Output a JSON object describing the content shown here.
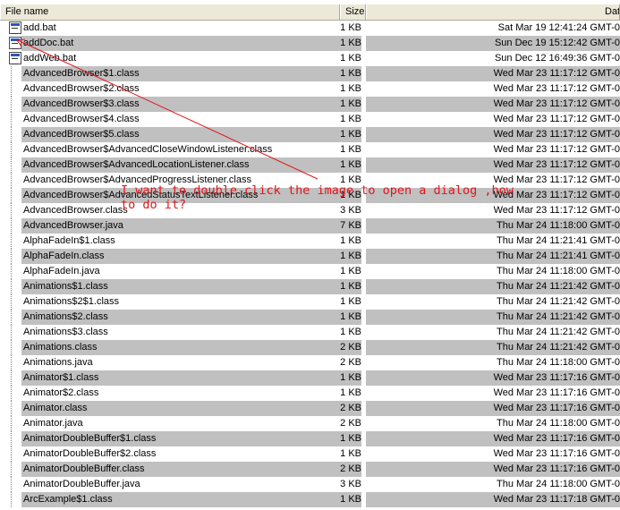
{
  "columns": {
    "name": "File name",
    "size": "Size",
    "date": "Date"
  },
  "annotation": {
    "line1": "I want to double click the image to open a dialog ,how",
    "line2": "to do it?",
    "color": "#e0161b"
  },
  "files": [
    {
      "name": "add.bat",
      "size": "1 KB",
      "date": "Sat Mar 19 12:41:24 GMT-0",
      "icon": "batch-file-icon"
    },
    {
      "name": "addDoc.bat",
      "size": "1 KB",
      "date": "Sun Dec 19 15:12:42 GMT-0",
      "icon": "batch-file-icon"
    },
    {
      "name": "addWeb.bat",
      "size": "1 KB",
      "date": "Sun Dec 12 16:49:36 GMT-0",
      "icon": "batch-file-icon"
    },
    {
      "name": "AdvancedBrowser$1.class",
      "size": "1 KB",
      "date": "Wed Mar 23 11:17:12 GMT-0"
    },
    {
      "name": "AdvancedBrowser$2.class",
      "size": "1 KB",
      "date": "Wed Mar 23 11:17:12 GMT-0"
    },
    {
      "name": "AdvancedBrowser$3.class",
      "size": "1 KB",
      "date": "Wed Mar 23 11:17:12 GMT-0"
    },
    {
      "name": "AdvancedBrowser$4.class",
      "size": "1 KB",
      "date": "Wed Mar 23 11:17:12 GMT-0"
    },
    {
      "name": "AdvancedBrowser$5.class",
      "size": "1 KB",
      "date": "Wed Mar 23 11:17:12 GMT-0"
    },
    {
      "name": "AdvancedBrowser$AdvancedCloseWindowListener.class",
      "size": "1 KB",
      "date": "Wed Mar 23 11:17:12 GMT-0"
    },
    {
      "name": "AdvancedBrowser$AdvancedLocationListener.class",
      "size": "1 KB",
      "date": "Wed Mar 23 11:17:12 GMT-0"
    },
    {
      "name": "AdvancedBrowser$AdvancedProgressListener.class",
      "size": "1 KB",
      "date": "Wed Mar 23 11:17:12 GMT-0"
    },
    {
      "name": "AdvancedBrowser$AdvancedStatusTextListener.class",
      "size": "1 KB",
      "date": "Wed Mar 23 11:17:12 GMT-0"
    },
    {
      "name": "AdvancedBrowser.class",
      "size": "3 KB",
      "date": "Wed Mar 23 11:17:12 GMT-0"
    },
    {
      "name": "AdvancedBrowser.java",
      "size": "7 KB",
      "date": "Thu Mar 24 11:18:00 GMT-0"
    },
    {
      "name": "AlphaFadeIn$1.class",
      "size": "1 KB",
      "date": "Thu Mar 24 11:21:41 GMT-0"
    },
    {
      "name": "AlphaFadeIn.class",
      "size": "1 KB",
      "date": "Thu Mar 24 11:21:41 GMT-0"
    },
    {
      "name": "AlphaFadeIn.java",
      "size": "1 KB",
      "date": "Thu Mar 24 11:18:00 GMT-0"
    },
    {
      "name": "Animations$1.class",
      "size": "1 KB",
      "date": "Thu Mar 24 11:21:42 GMT-0"
    },
    {
      "name": "Animations$2$1.class",
      "size": "1 KB",
      "date": "Thu Mar 24 11:21:42 GMT-0"
    },
    {
      "name": "Animations$2.class",
      "size": "1 KB",
      "date": "Thu Mar 24 11:21:42 GMT-0"
    },
    {
      "name": "Animations$3.class",
      "size": "1 KB",
      "date": "Thu Mar 24 11:21:42 GMT-0"
    },
    {
      "name": "Animations.class",
      "size": "2 KB",
      "date": "Thu Mar 24 11:21:42 GMT-0"
    },
    {
      "name": "Animations.java",
      "size": "2 KB",
      "date": "Thu Mar 24 11:18:00 GMT-0"
    },
    {
      "name": "Animator$1.class",
      "size": "1 KB",
      "date": "Wed Mar 23 11:17:16 GMT-0"
    },
    {
      "name": "Animator$2.class",
      "size": "1 KB",
      "date": "Wed Mar 23 11:17:16 GMT-0"
    },
    {
      "name": "Animator.class",
      "size": "2 KB",
      "date": "Wed Mar 23 11:17:16 GMT-0"
    },
    {
      "name": "Animator.java",
      "size": "2 KB",
      "date": "Thu Mar 24 11:18:00 GMT-0"
    },
    {
      "name": "AnimatorDoubleBuffer$1.class",
      "size": "1 KB",
      "date": "Wed Mar 23 11:17:16 GMT-0"
    },
    {
      "name": "AnimatorDoubleBuffer$2.class",
      "size": "1 KB",
      "date": "Wed Mar 23 11:17:16 GMT-0"
    },
    {
      "name": "AnimatorDoubleBuffer.class",
      "size": "2 KB",
      "date": "Wed Mar 23 11:17:16 GMT-0"
    },
    {
      "name": "AnimatorDoubleBuffer.java",
      "size": "3 KB",
      "date": "Thu Mar 24 11:18:00 GMT-0"
    },
    {
      "name": "ArcExample$1.class",
      "size": "1 KB",
      "date": "Wed Mar 23 11:17:18 GMT-0"
    }
  ]
}
